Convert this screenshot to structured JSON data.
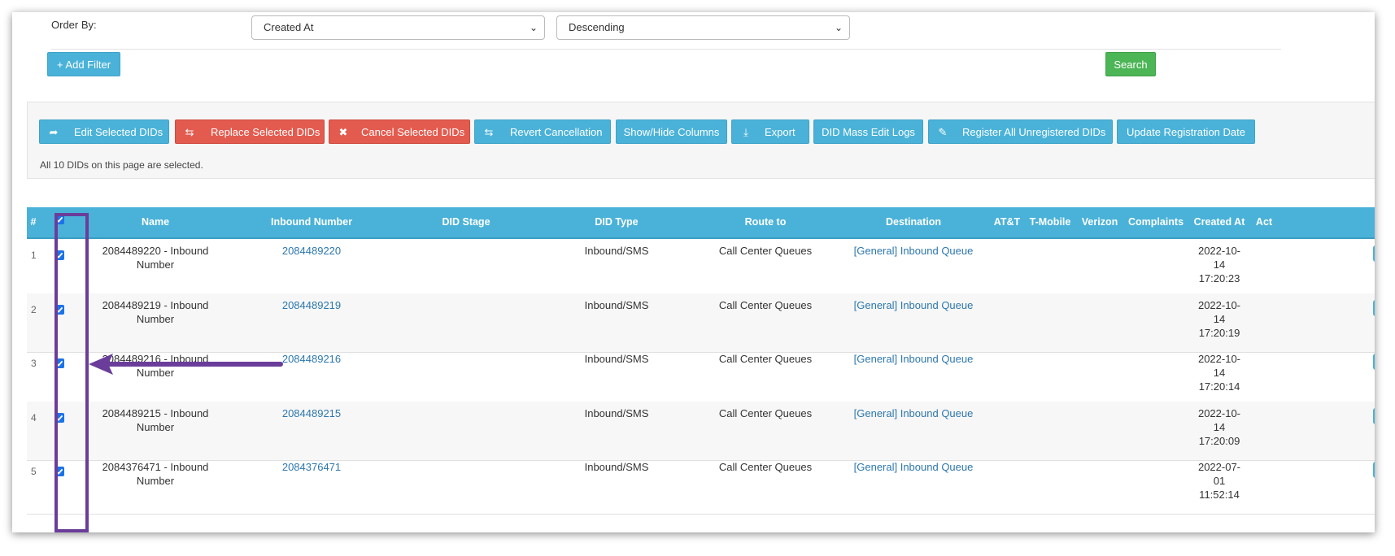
{
  "filters": {
    "order_by_label": "Order By:",
    "order_field": "Created At",
    "order_direction": "Descending",
    "add_filter_label": "+ Add Filter",
    "search_label": "Search"
  },
  "toolbar": {
    "edit": "Edit Selected DIDs",
    "replace": "Replace Selected DIDs",
    "cancel": "Cancel Selected DIDs",
    "revert": "Revert Cancellation",
    "show_hide": "Show/Hide Columns",
    "export": "Export",
    "mass_logs": "DID Mass Edit Logs",
    "register": "Register All Unregistered DIDs",
    "update_reg": "Update Registration Date"
  },
  "selection_note": "All 10 DIDs on this page are selected.",
  "table": {
    "headers": {
      "num": "#",
      "name": "Name",
      "inbound": "Inbound Number",
      "stage": "DID Stage",
      "type": "DID Type",
      "route": "Route to",
      "destination": "Destination",
      "att": "AT&T",
      "tmobile": "T-Mobile",
      "verizon": "Verizon",
      "complaints": "Complaints",
      "created": "Created At",
      "actions": "Act"
    },
    "rows": [
      {
        "num": "1",
        "name_1": "2084489220 - Inbound",
        "name_2": "Number",
        "inbound": "2084489220",
        "type": "Inbound/SMS",
        "route": "Call Center Queues",
        "destination": "[General] Inbound Queue",
        "c1": "2022-10-",
        "c2": "14",
        "c3": "17:20:23",
        "checked": true
      },
      {
        "num": "2",
        "name_1": "2084489219 - Inbound",
        "name_2": "Number",
        "inbound": "2084489219",
        "type": "Inbound/SMS",
        "route": "Call Center Queues",
        "destination": "[General] Inbound Queue",
        "c1": "2022-10-",
        "c2": "14",
        "c3": "17:20:19",
        "checked": true
      },
      {
        "num": "3",
        "name_1": "2084489216 - Inbound",
        "name_2": "Number",
        "inbound": "2084489216",
        "type": "Inbound/SMS",
        "route": "Call Center Queues",
        "destination": "[General] Inbound Queue",
        "c1": "2022-10-",
        "c2": "14",
        "c3": "17:20:14",
        "checked": true
      },
      {
        "num": "4",
        "name_1": "2084489215 - Inbound",
        "name_2": "Number",
        "inbound": "2084489215",
        "type": "Inbound/SMS",
        "route": "Call Center Queues",
        "destination": "[General] Inbound Queue",
        "c1": "2022-10-",
        "c2": "14",
        "c3": "17:20:09",
        "checked": true
      },
      {
        "num": "5",
        "name_1": "2084376471 - Inbound",
        "name_2": "Number",
        "inbound": "2084376471",
        "type": "Inbound/SMS",
        "route": "Call Center Queues",
        "destination": "[General] Inbound Queue",
        "c1": "2022-07-",
        "c2": "01",
        "c3": "11:52:14",
        "checked": true
      }
    ]
  },
  "colors": {
    "header": "#4ab2d8",
    "danger": "#e35b4f",
    "success": "#4cb556",
    "link": "#2d77ae",
    "annotation": "#6b3d9a"
  },
  "icons": {
    "edit": "share-arrow-icon",
    "replace": "retweet-icon",
    "cancel": "times-icon",
    "revert": "retweet-icon",
    "export": "download-icon",
    "register": "pencil-square-icon",
    "actions": "gear-icon"
  }
}
